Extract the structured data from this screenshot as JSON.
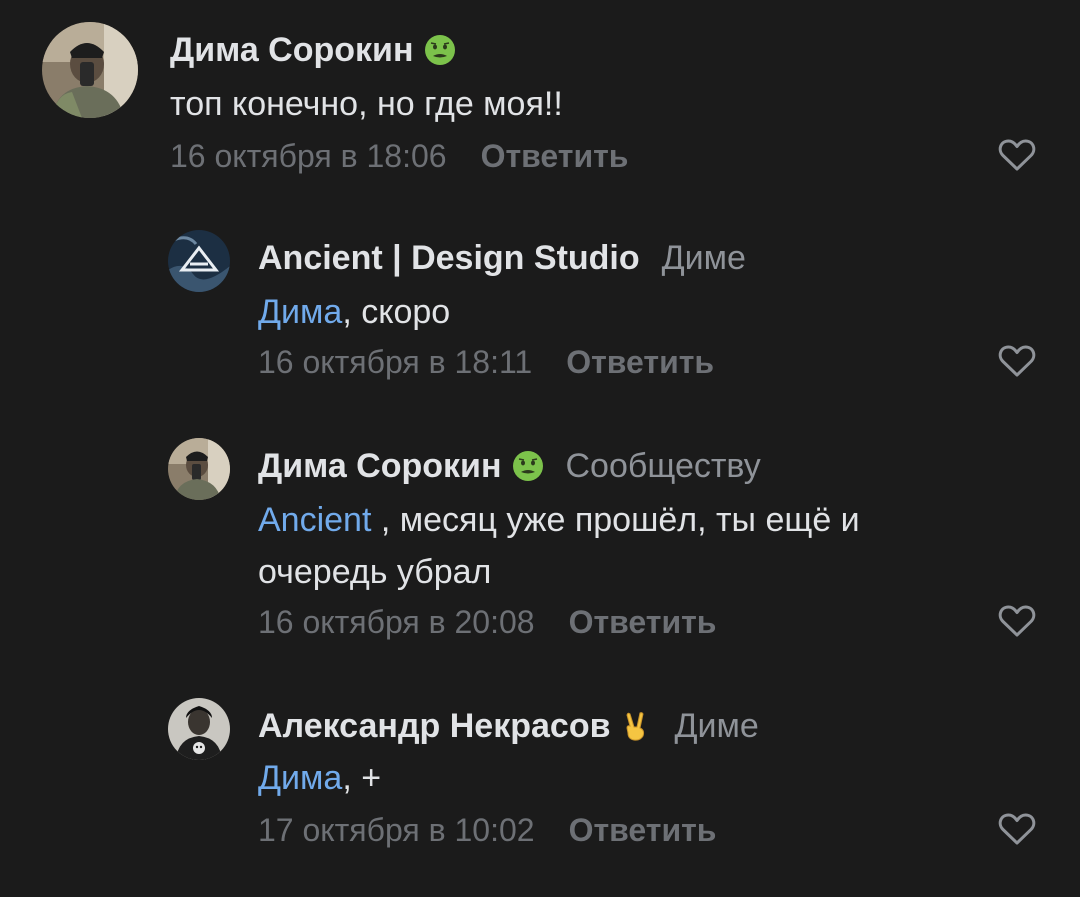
{
  "comments": [
    {
      "author": "Дима Сорокин",
      "badge_icon": "nauseated-face-emoji-icon",
      "target": "",
      "mention": "",
      "text": "топ конечно, но где моя!!",
      "date": "16 октября в 18:06",
      "reply_label": "Ответить"
    },
    {
      "author": "Ancient | Design Studio",
      "target": "Диме",
      "mention": "Дима",
      "text": ", скоро",
      "date": "16 октября в 18:11",
      "reply_label": "Ответить"
    },
    {
      "author": "Дима Сорокин",
      "badge_icon": "nauseated-face-emoji-icon",
      "target": "Сообществу",
      "mention": "Ancient",
      "text": " , месяц уже прошёл, ты ещё и очередь убрал",
      "date": "16 октября в 20:08",
      "reply_label": "Ответить"
    },
    {
      "author": "Александр Некрасов",
      "badge_icon": "victory-hand-emoji-icon",
      "target": "Диме",
      "mention": "Дима",
      "text": ", +",
      "date": "17 октября в 10:02",
      "reply_label": "Ответить"
    }
  ],
  "colors": {
    "background": "#1b1b1b",
    "text": "#e1e3e6",
    "secondary": "#8f9399",
    "muted": "#6d7075",
    "link": "#71aaeb",
    "badge_green": "#7cc24b"
  }
}
